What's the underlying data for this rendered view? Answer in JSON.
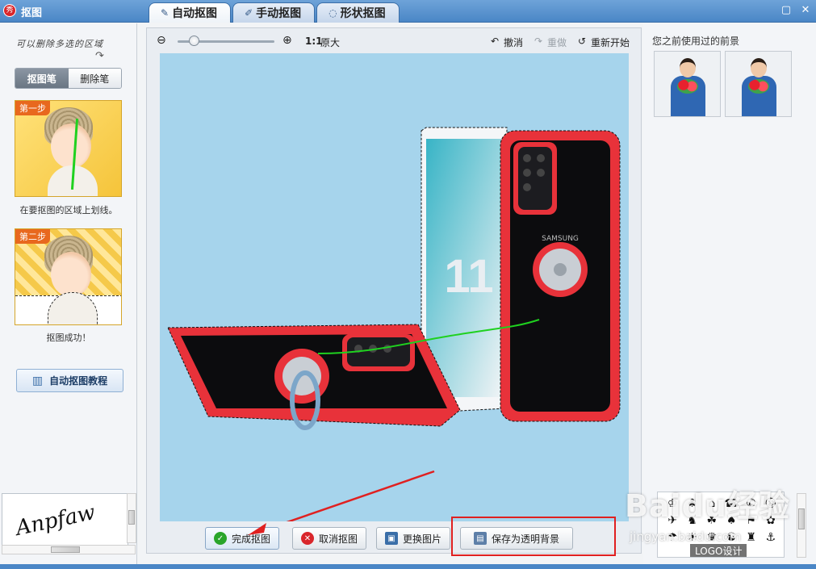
{
  "window": {
    "title": "抠图",
    "app_icon_text": "秀"
  },
  "tabs": [
    {
      "label": "自动抠图",
      "icon": "brush-icon",
      "active": true
    },
    {
      "label": "手动抠图",
      "icon": "pen-icon",
      "active": false
    },
    {
      "label": "形状抠图",
      "icon": "shape-icon",
      "active": false
    }
  ],
  "left_panel": {
    "hint": "可以删除多选的区域",
    "pen_buttons": [
      {
        "label": "抠图笔",
        "active": true
      },
      {
        "label": "删除笔",
        "active": false
      }
    ],
    "step1": {
      "badge": "第一步",
      "caption": "在要抠图的区域上划线。"
    },
    "step2": {
      "badge": "第二步",
      "caption": "抠图成功！"
    },
    "tutorial_button": "自动抠图教程"
  },
  "toolbar": {
    "zoom_ratio": "1:1",
    "original_size": "原大",
    "undo": "撤消",
    "redo": "重做",
    "restart": "重新开始"
  },
  "canvas": {
    "background": "#a6d4ec",
    "phone_brand": "SAMSUNG",
    "screen_number": "11"
  },
  "actions": {
    "finish": "完成抠图",
    "cancel": "取消抠图",
    "replace": "更换图片",
    "save_transparent": "保存为透明背景"
  },
  "right_panel": {
    "title": "您之前使用过的前景",
    "logo_label": "LOGO设计"
  },
  "watermark": {
    "main": "Baidu经验",
    "sub": "jingyan.baidu.com"
  },
  "colors": {
    "accent": "#4a86c6",
    "highlight": "#e02020",
    "stroke": "#1fd11f",
    "phone_red": "#e8323a"
  }
}
